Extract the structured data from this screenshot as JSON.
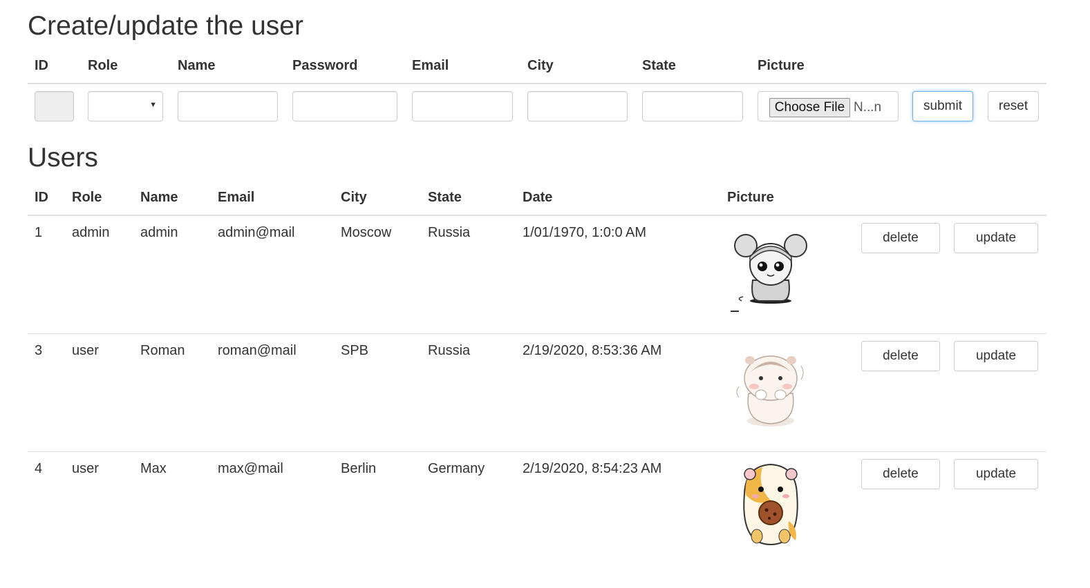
{
  "form": {
    "title": "Create/update the user",
    "headers": [
      "ID",
      "Role",
      "Name",
      "Password",
      "Email",
      "City",
      "State",
      "Picture"
    ],
    "file_button": "Choose File",
    "file_name": "N...n",
    "submit": "submit",
    "reset": "reset"
  },
  "users": {
    "title": "Users",
    "headers": [
      "ID",
      "Role",
      "Name",
      "Email",
      "City",
      "State",
      "Date",
      "Picture"
    ],
    "delete_label": "delete",
    "update_label": "update",
    "rows": [
      {
        "id": "1",
        "role": "admin",
        "name": "admin",
        "email": "admin@mail",
        "city": "Moscow",
        "state": "Russia",
        "date": "1/01/1970, 1:0:0 AM",
        "picture": "hamster-sketch"
      },
      {
        "id": "3",
        "role": "user",
        "name": "Roman",
        "email": "roman@mail",
        "city": "SPB",
        "state": "Russia",
        "date": "2/19/2020, 8:53:36 AM",
        "picture": "hamster-watercolor"
      },
      {
        "id": "4",
        "role": "user",
        "name": "Max",
        "email": "max@mail",
        "city": "Berlin",
        "state": "Germany",
        "date": "2/19/2020, 8:54:23 AM",
        "picture": "hamster-cookie"
      }
    ]
  }
}
